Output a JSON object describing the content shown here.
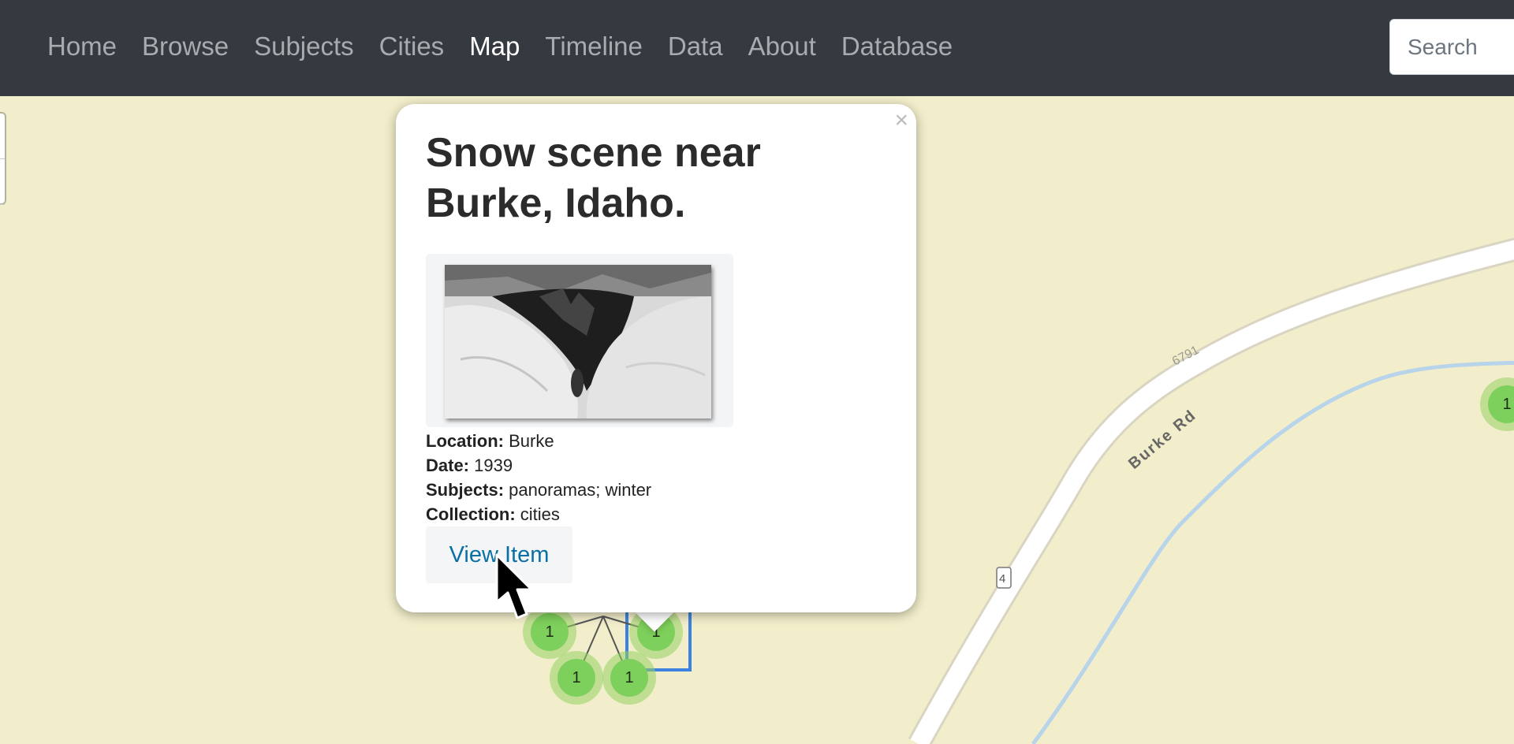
{
  "nav": {
    "items": [
      {
        "label": "Home"
      },
      {
        "label": "Browse"
      },
      {
        "label": "Subjects"
      },
      {
        "label": "Cities"
      },
      {
        "label": "Map",
        "active": true
      },
      {
        "label": "Timeline"
      },
      {
        "label": "Data"
      },
      {
        "label": "About"
      },
      {
        "label": "Database"
      }
    ],
    "search_placeholder": "Search"
  },
  "map": {
    "road_label": "Burke Rd",
    "elevation_label": "6791",
    "route_shield": "4",
    "clusters": [
      "1",
      "1",
      "1",
      "1",
      "1"
    ]
  },
  "popup": {
    "close_glyph": "×",
    "title": "Snow scene near Burke, Idaho.",
    "location_label": "Location:",
    "location_value": "Burke",
    "date_label": "Date:",
    "date_value": "1939",
    "subjects_label": "Subjects:",
    "subjects_value": "panoramas; winter",
    "collection_label": "Collection:",
    "collection_value": "cities",
    "view_button": "View Item"
  },
  "colors": {
    "navbar": "#343a40",
    "map_land": "#f2eecb",
    "cluster": "#7ed05c",
    "link": "#0a6fa3"
  }
}
